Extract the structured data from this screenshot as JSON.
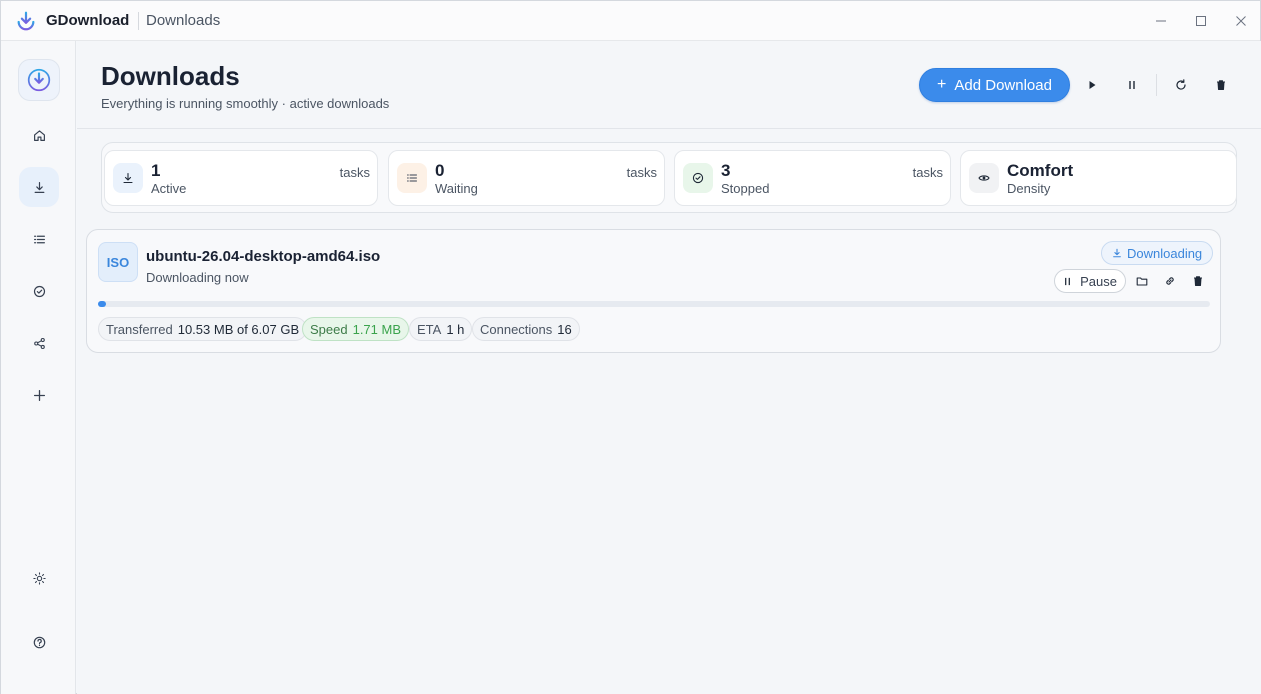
{
  "titlebar": {
    "app_name": "GDownload",
    "window_title": "Downloads",
    "controls": [
      "minimize",
      "maximize",
      "close"
    ]
  },
  "sidebar": {
    "logo": "gdownload-logo",
    "items": [
      {
        "id": "home",
        "icon": "home-icon",
        "active": false
      },
      {
        "id": "downloads",
        "icon": "download-icon",
        "active": true
      },
      {
        "id": "queue",
        "icon": "list-icon",
        "active": false
      },
      {
        "id": "completed",
        "icon": "check-circle-icon",
        "active": false
      },
      {
        "id": "share",
        "icon": "share-icon",
        "active": false
      },
      {
        "id": "add",
        "icon": "plus-icon",
        "active": false
      }
    ],
    "bottom_items": [
      {
        "id": "theme",
        "icon": "sun-icon"
      },
      {
        "id": "help",
        "icon": "help-icon"
      }
    ]
  },
  "header": {
    "title": "Downloads",
    "subtitle": "Everything is running smoothly · active downloads",
    "add_button_label": "Add Download",
    "toolbar": [
      "play-icon",
      "pause-icon",
      "refresh-icon",
      "trash-icon"
    ]
  },
  "stats": [
    {
      "value": "1",
      "label": "Active",
      "unit": "tasks",
      "icon": "download-icon",
      "color": "#3b86db"
    },
    {
      "value": "0",
      "label": "Waiting",
      "unit": "tasks",
      "icon": "list-icon",
      "color": "#e08a3c"
    },
    {
      "value": "3",
      "label": "Stopped",
      "unit": "tasks",
      "icon": "check-circle-icon",
      "color": "#3aa34c"
    },
    {
      "value": "Comfort",
      "label": "Density",
      "unit": "",
      "icon": "eye-icon",
      "color": "#4b5563"
    }
  ],
  "downloads": [
    {
      "badge": "ISO",
      "file_name": "ubuntu-26.04-desktop-amd64.iso",
      "status_text": "Downloading now",
      "status_pill": "Downloading",
      "pause_label": "Pause",
      "progress": 0.0017,
      "transferred_label": "Transferred",
      "transferred_value": "10.53 MB of 6.07 GB",
      "speed_label": "Speed",
      "speed_value": "1.71 MB",
      "eta_label": "ETA",
      "eta_value": "1 h",
      "connections_label": "Connections",
      "connections_value": "16"
    }
  ],
  "colors": {
    "accent": "#3b8beb",
    "speed_green": "#3aa34c"
  }
}
